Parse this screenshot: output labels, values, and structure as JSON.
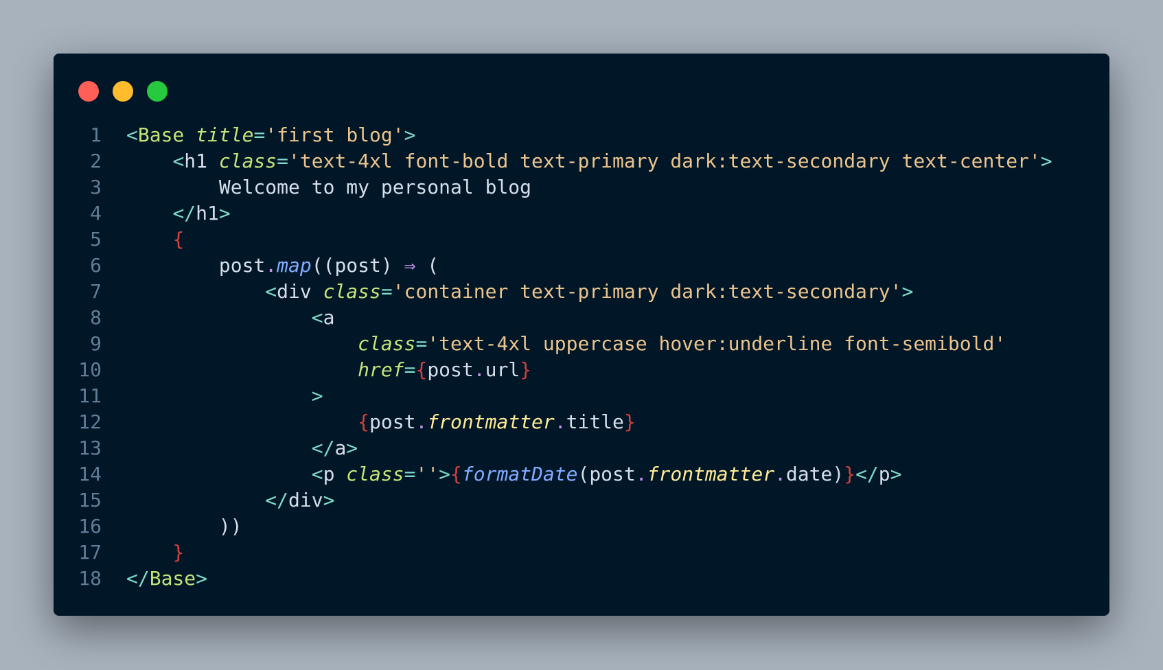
{
  "window": {
    "background": "#011627",
    "buttons": [
      {
        "name": "close",
        "color": "#ff5f56"
      },
      {
        "name": "minimize",
        "color": "#ffbd2e"
      },
      {
        "name": "zoom",
        "color": "#27c93f"
      }
    ]
  },
  "colors": {
    "tag_bracket": "#7fdbca",
    "component": "#caece6",
    "attr": "#c5e478",
    "string": "#ecc48d",
    "brace": "#d3423e",
    "method": "#82aaff",
    "prop": "#ffeb95",
    "arrow": "#c792ea",
    "text": "#d6deeb",
    "dot": "#c792ea",
    "line_number": "#5f7e97"
  },
  "lines": [
    {
      "n": "1",
      "tokens": [
        [
          "<",
          "tag_bracket"
        ],
        [
          "Base",
          "attr"
        ],
        [
          " ",
          "text"
        ],
        [
          "title",
          "attr_i"
        ],
        [
          "=",
          "tag_bracket"
        ],
        [
          "'first blog'",
          "string"
        ],
        [
          ">",
          "tag_bracket"
        ]
      ]
    },
    {
      "n": "2",
      "tokens": [
        [
          "    ",
          "text"
        ],
        [
          "<",
          "tag_bracket"
        ],
        [
          "h1",
          "text"
        ],
        [
          " ",
          "text"
        ],
        [
          "class",
          "attr_i"
        ],
        [
          "=",
          "tag_bracket"
        ],
        [
          "'text-4xl font-bold text-primary dark:text-secondary text-center'",
          "string"
        ],
        [
          ">",
          "tag_bracket"
        ]
      ]
    },
    {
      "n": "3",
      "tokens": [
        [
          "        Welcome to my personal blog",
          "text"
        ]
      ]
    },
    {
      "n": "4",
      "tokens": [
        [
          "    ",
          "text"
        ],
        [
          "</",
          "tag_bracket"
        ],
        [
          "h1",
          "text"
        ],
        [
          ">",
          "tag_bracket"
        ]
      ]
    },
    {
      "n": "5",
      "tokens": [
        [
          "    ",
          "text"
        ],
        [
          "{",
          "brace"
        ]
      ]
    },
    {
      "n": "6",
      "tokens": [
        [
          "        post",
          "text"
        ],
        [
          ".",
          "dot"
        ],
        [
          "map",
          "method_i"
        ],
        [
          "((post) ",
          "text"
        ],
        [
          "⇒",
          "arrow"
        ],
        [
          " (",
          "text"
        ]
      ]
    },
    {
      "n": "7",
      "tokens": [
        [
          "            ",
          "text"
        ],
        [
          "<",
          "tag_bracket"
        ],
        [
          "div",
          "text"
        ],
        [
          " ",
          "text"
        ],
        [
          "class",
          "attr_i"
        ],
        [
          "=",
          "tag_bracket"
        ],
        [
          "'container text-primary dark:text-secondary'",
          "string"
        ],
        [
          ">",
          "tag_bracket"
        ]
      ]
    },
    {
      "n": "8",
      "tokens": [
        [
          "                ",
          "text"
        ],
        [
          "<",
          "tag_bracket"
        ],
        [
          "a",
          "text"
        ]
      ]
    },
    {
      "n": "9",
      "tokens": [
        [
          "                    ",
          "text"
        ],
        [
          "class",
          "attr_i"
        ],
        [
          "=",
          "tag_bracket"
        ],
        [
          "'text-4xl uppercase hover:underline font-semibold'",
          "string"
        ]
      ]
    },
    {
      "n": "10",
      "tokens": [
        [
          "                    ",
          "text"
        ],
        [
          "href",
          "attr_i"
        ],
        [
          "=",
          "tag_bracket"
        ],
        [
          "{",
          "brace"
        ],
        [
          "post",
          "text"
        ],
        [
          ".",
          "dot"
        ],
        [
          "url",
          "text"
        ],
        [
          "}",
          "brace"
        ]
      ]
    },
    {
      "n": "11",
      "tokens": [
        [
          "                ",
          "text"
        ],
        [
          ">",
          "tag_bracket"
        ]
      ]
    },
    {
      "n": "12",
      "tokens": [
        [
          "                    ",
          "text"
        ],
        [
          "{",
          "brace"
        ],
        [
          "post",
          "text"
        ],
        [
          ".",
          "dot"
        ],
        [
          "frontmatter",
          "prop_i"
        ],
        [
          ".",
          "dot"
        ],
        [
          "title",
          "text"
        ],
        [
          "}",
          "brace"
        ]
      ]
    },
    {
      "n": "13",
      "tokens": [
        [
          "                ",
          "text"
        ],
        [
          "</",
          "tag_bracket"
        ],
        [
          "a",
          "text"
        ],
        [
          ">",
          "tag_bracket"
        ]
      ]
    },
    {
      "n": "14",
      "tokens": [
        [
          "                ",
          "text"
        ],
        [
          "<",
          "tag_bracket"
        ],
        [
          "p",
          "text"
        ],
        [
          " ",
          "text"
        ],
        [
          "class",
          "attr_i"
        ],
        [
          "=",
          "tag_bracket"
        ],
        [
          "''",
          "string"
        ],
        [
          ">",
          "tag_bracket"
        ],
        [
          "{",
          "brace"
        ],
        [
          "formatDate",
          "method_i"
        ],
        [
          "(post",
          "text"
        ],
        [
          ".",
          "dot"
        ],
        [
          "frontmatter",
          "prop_i"
        ],
        [
          ".",
          "dot"
        ],
        [
          "date)",
          "text"
        ],
        [
          "}",
          "brace"
        ],
        [
          "</",
          "tag_bracket"
        ],
        [
          "p",
          "text"
        ],
        [
          ">",
          "tag_bracket"
        ]
      ]
    },
    {
      "n": "15",
      "tokens": [
        [
          "            ",
          "text"
        ],
        [
          "</",
          "tag_bracket"
        ],
        [
          "div",
          "text"
        ],
        [
          ">",
          "tag_bracket"
        ]
      ]
    },
    {
      "n": "16",
      "tokens": [
        [
          "        ))",
          "text"
        ]
      ]
    },
    {
      "n": "17",
      "tokens": [
        [
          "    ",
          "text"
        ],
        [
          "}",
          "brace"
        ]
      ]
    },
    {
      "n": "18",
      "tokens": [
        [
          "</",
          "tag_bracket"
        ],
        [
          "Base",
          "attr"
        ],
        [
          ">",
          "tag_bracket"
        ]
      ]
    }
  ]
}
